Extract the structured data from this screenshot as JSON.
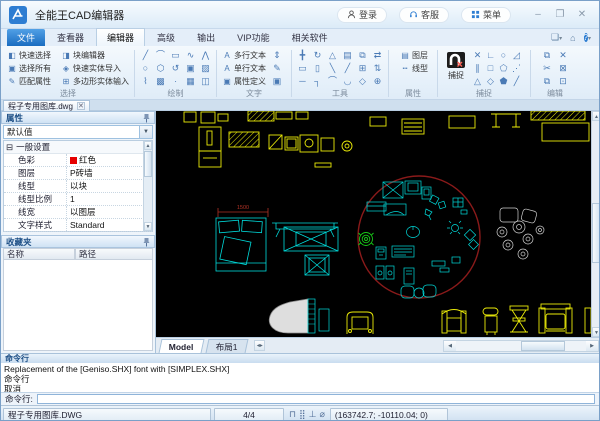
{
  "window": {
    "title": "全能王CAD编辑器",
    "login": "登录",
    "service": "客服",
    "menu": "菜单",
    "minimize": "–",
    "maximize": "❐",
    "close": "✕"
  },
  "quick_access": {
    "new_drawing": "❏",
    "home": "⌂",
    "help": "?",
    "caret": "▾"
  },
  "ribbon_tabs": [
    "文件",
    "查看器",
    "编辑器",
    "高级",
    "输出",
    "VIP功能",
    "相关软件"
  ],
  "ribbon": {
    "select_group": {
      "label": "选择",
      "col1": [
        {
          "icon": "◧",
          "label": "快速选择"
        },
        {
          "icon": "▣",
          "label": "选择所有"
        },
        {
          "icon": "✎",
          "label": "匹配属性"
        }
      ],
      "col2": [
        {
          "icon": "◨",
          "label": "块编辑器"
        },
        {
          "icon": "◈",
          "label": "快速实体导入"
        },
        {
          "icon": "⊞",
          "label": "多边形实体输入"
        }
      ]
    },
    "draw_group": {
      "label": "绘制",
      "icons": [
        "╱",
        "⌒",
        "▭",
        "∿",
        "⋀",
        "○",
        "⬡",
        "↺",
        "▣",
        "▨",
        "⌇",
        "▩",
        "∙",
        "▦",
        "◫"
      ]
    },
    "text_group": {
      "label": "文字",
      "buttons": [
        {
          "icon": "A",
          "label": "多行文本"
        },
        {
          "icon": "A",
          "label": "单行文本"
        },
        {
          "icon": "▣",
          "label": "属性定义"
        }
      ],
      "side_icons": [
        "⇕",
        "✎",
        "▣"
      ]
    },
    "tools_group": {
      "label": "工具",
      "icons": [
        "╋",
        "↻",
        "△",
        "▤",
        "⧉",
        "⇄",
        "▭",
        "▯",
        "╲",
        "╱",
        "⊞",
        "⇅",
        "─",
        "┐",
        "⌒",
        "◡",
        "◇",
        "⊕"
      ]
    },
    "props_group": {
      "label": "属性",
      "buttons": [
        {
          "icon": "▤",
          "label": "图层"
        },
        {
          "icon": "┅",
          "label": "线型"
        }
      ]
    },
    "snap_group": {
      "label": "捕捉",
      "big_label": "捕捉",
      "icons": [
        "✕",
        "∟",
        "○",
        "◿",
        "∥",
        "□",
        "⬠",
        "⋰",
        "△",
        "◇",
        "⬟",
        "╱"
      ]
    },
    "edit_group": {
      "label": "编辑",
      "icons": [
        "⧉",
        "✕",
        "✂",
        "⊠",
        "⧉",
        "⊡"
      ]
    }
  },
  "document_tab": {
    "name": "程子专用图库.dwg",
    "close": "✕"
  },
  "properties_panel": {
    "title": "属性",
    "preset": "默认值",
    "section": "一般设置",
    "section_toggle": "⊟",
    "rows": [
      {
        "label": "色彩",
        "value": "红色",
        "swatch": "#e60000"
      },
      {
        "label": "图层",
        "value": "P砖墙"
      },
      {
        "label": "线型",
        "value": "以块"
      },
      {
        "label": "线型比例",
        "value": "1"
      },
      {
        "label": "线宽",
        "value": "以图层"
      },
      {
        "label": "文字样式",
        "value": "Standard"
      }
    ]
  },
  "favorites_panel": {
    "title": "收藏夹",
    "columns": [
      "名称",
      "路径"
    ]
  },
  "canvas": {
    "dimension_label": "1500",
    "model_tabs": [
      "Model",
      "布局1"
    ],
    "colors": {
      "background": "#000000",
      "blocks_yellow": "#ecec08",
      "furniture_cyan": "#00dcdc",
      "highlight_circle": "#8a1a1a",
      "plant_green": "#17c817",
      "misc_white": "#d0d0d0",
      "dimension_red": "#b23226"
    }
  },
  "command_panel": {
    "title": "命令行",
    "history": [
      "Replacement of the [Geniso.SHX] font with [SIMPLEX.SHX]",
      "命令行",
      "取消"
    ],
    "prompt_label": "命令行:",
    "input_value": ""
  },
  "status_bar": {
    "filename": "程子专用图库.DWG",
    "counter": "4/4",
    "icons": [
      "⊓",
      "⣿",
      "⊥",
      "⌀"
    ],
    "coordinates": "(163742.7; -10110.04; 0)"
  }
}
